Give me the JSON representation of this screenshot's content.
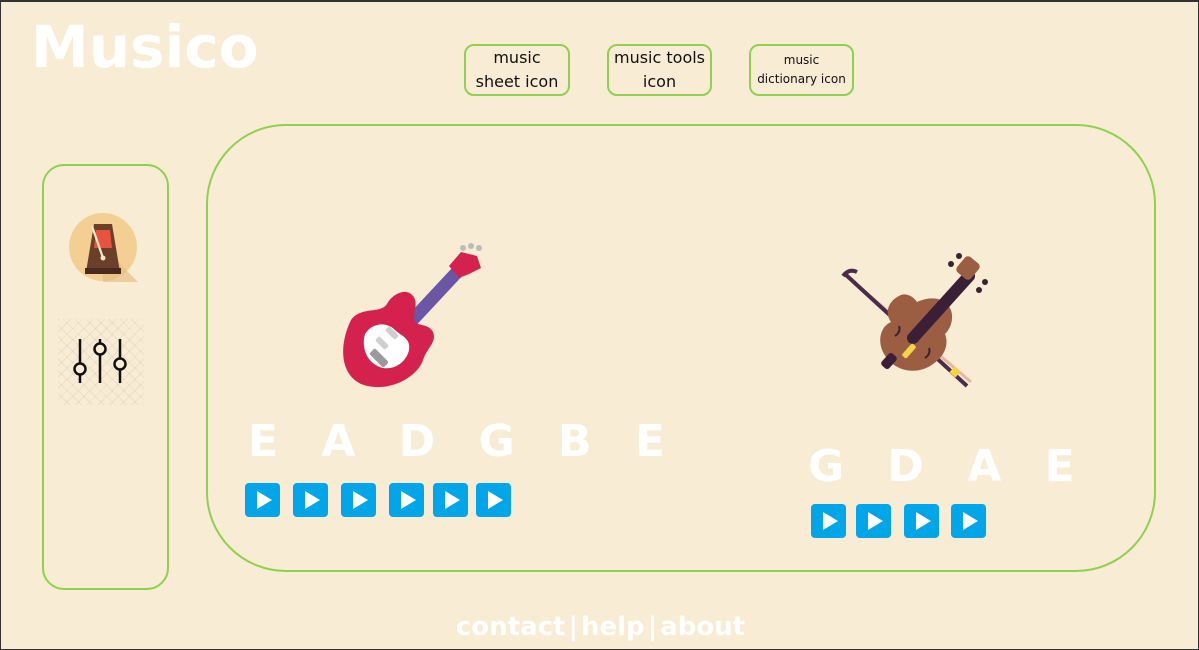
{
  "app": {
    "logo": "Musico"
  },
  "top_nav": {
    "music_sheet": "music sheet icon",
    "music_tools": "music tools icon",
    "music_dictionary": "music dictionary icon"
  },
  "sidebar": {
    "items": [
      {
        "icon": "metronome-icon"
      },
      {
        "icon": "mixer-sliders-icon"
      }
    ]
  },
  "instruments": [
    {
      "icon": "electric-guitar-icon",
      "tuning": "E A D G B E",
      "notes": [
        "E",
        "A",
        "D",
        "G",
        "B",
        "E"
      ]
    },
    {
      "icon": "violin-icon",
      "tuning": "G D A E",
      "notes": [
        "G",
        "D",
        "A",
        "E"
      ]
    }
  ],
  "footer": {
    "contact": "contact",
    "separator": "|",
    "help": "help",
    "about": "about"
  },
  "colors": {
    "background": "#f8ecd4",
    "border_green": "#8fd14f",
    "play_blue": "#00a6e8",
    "white_text": "#ffffff"
  }
}
